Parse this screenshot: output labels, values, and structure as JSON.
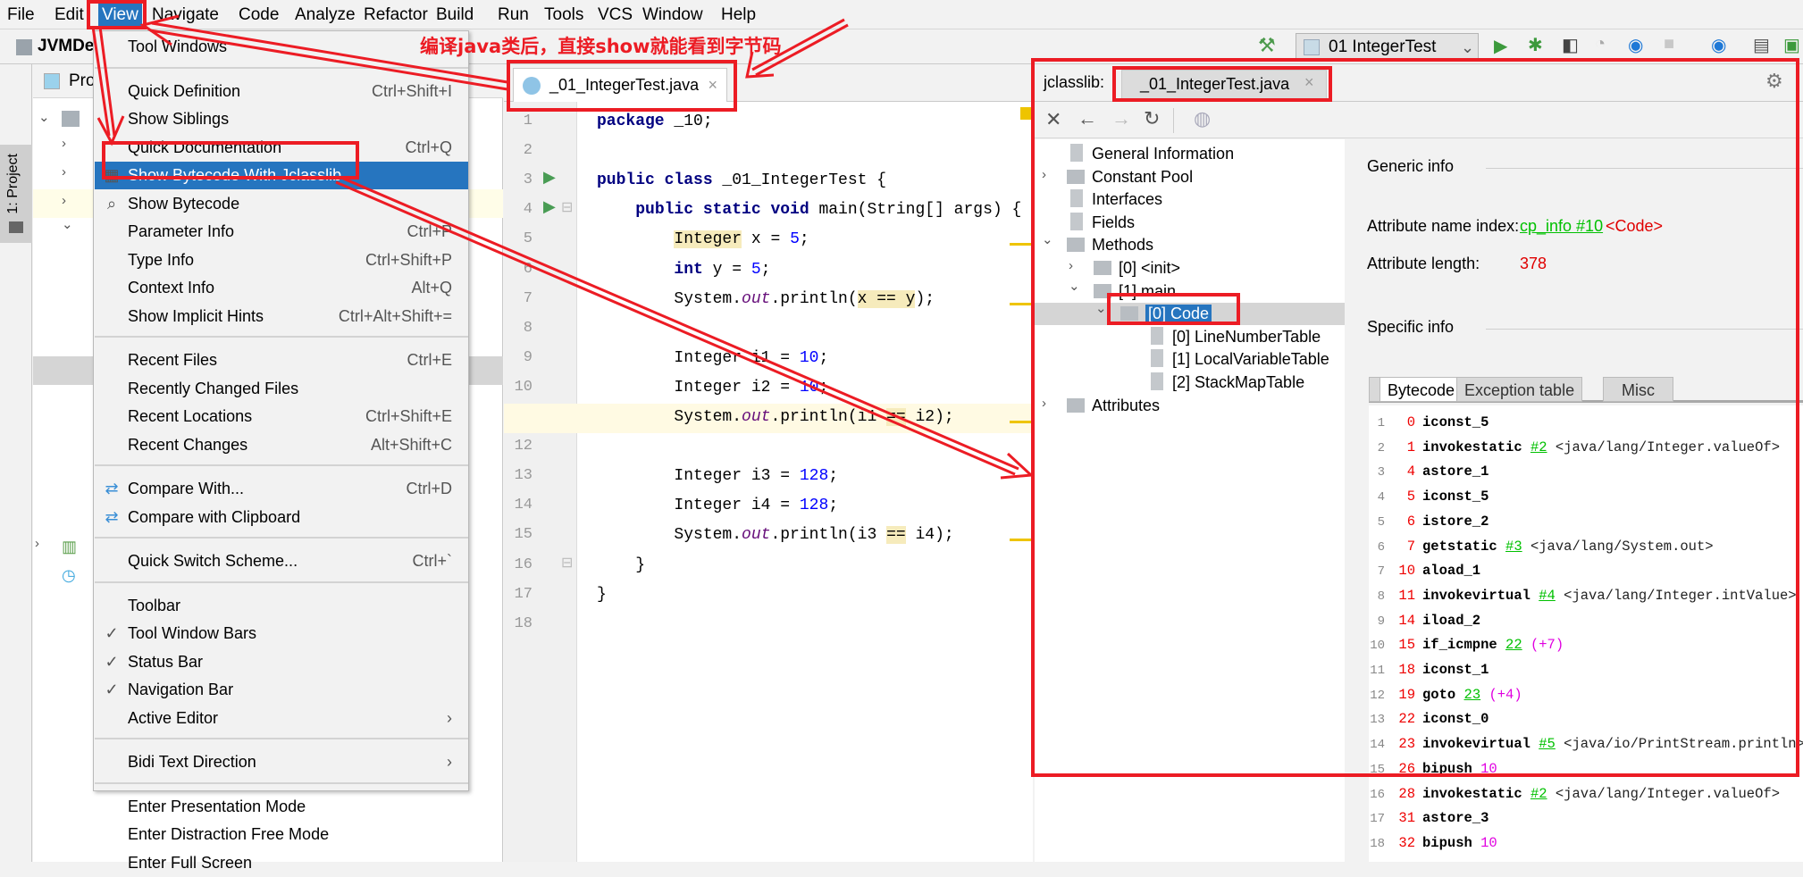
{
  "menubar": [
    "File",
    "Edit",
    "View",
    "Navigate",
    "Code",
    "Analyze",
    "Refactor",
    "Build",
    "Run",
    "Tools",
    "VCS",
    "Window",
    "Help"
  ],
  "menubar_active": "View",
  "nav": {
    "project": "JVMDe",
    "run_config": "01 IntegerTest"
  },
  "stripe": {
    "project_tab": "1: Project"
  },
  "project_panel": {
    "title": "Pro"
  },
  "annotation": "编译java类后，直接show就能看到字节码",
  "editor": {
    "tab": "_01_IntegerTest.java",
    "lines": [
      [
        [
          "package",
          "kw"
        ],
        [
          " _10;",
          ""
        ]
      ],
      [],
      [
        [
          "public class",
          "kw"
        ],
        [
          " _01_IntegerTest {",
          ""
        ]
      ],
      [
        [
          "    ",
          " "
        ],
        [
          "public static void",
          "kw"
        ],
        [
          " main(String[] args) {",
          ""
        ]
      ],
      [
        [
          "        ",
          ""
        ],
        [
          "Integer",
          "hl"
        ],
        [
          " x = ",
          ""
        ],
        [
          "5",
          "num"
        ],
        [
          ";",
          ""
        ]
      ],
      [
        [
          "        ",
          ""
        ],
        [
          "int",
          "kw"
        ],
        [
          " y = ",
          ""
        ],
        [
          "5",
          "num"
        ],
        [
          ";",
          ""
        ]
      ],
      [
        [
          "        System.",
          ""
        ],
        [
          "out",
          "fld"
        ],
        [
          ".println(",
          ""
        ],
        [
          "x == y",
          "hl"
        ],
        [
          ");",
          ""
        ]
      ],
      [],
      [
        [
          "        Integer i1 = ",
          ""
        ],
        [
          "10",
          "num"
        ],
        [
          ";",
          ""
        ]
      ],
      [
        [
          "        Integer i2 = ",
          ""
        ],
        [
          "10",
          "num"
        ],
        [
          ";",
          ""
        ]
      ],
      [
        [
          "        System.",
          ""
        ],
        [
          "out",
          "fld"
        ],
        [
          ".println(i1 ",
          ""
        ],
        [
          "==",
          "hl"
        ],
        [
          " i2);",
          ""
        ]
      ],
      [],
      [
        [
          "        Integer i3 = ",
          ""
        ],
        [
          "128",
          "num"
        ],
        [
          ";",
          ""
        ]
      ],
      [
        [
          "        Integer i4 = ",
          ""
        ],
        [
          "128",
          "num"
        ],
        [
          ";",
          ""
        ]
      ],
      [
        [
          "        System.",
          ""
        ],
        [
          "out",
          "fld"
        ],
        [
          ".println(i3 ",
          ""
        ],
        [
          "==",
          "hl"
        ],
        [
          " i4);",
          ""
        ]
      ],
      [
        [
          "    }",
          ""
        ]
      ],
      [
        [
          "}",
          ""
        ]
      ],
      []
    ],
    "current_line": 11
  },
  "menu": {
    "items": [
      {
        "label": "Tool Windows",
        "shortcut": "",
        "submenu": true
      },
      {
        "sep": true
      },
      {
        "label": "Quick Definition",
        "shortcut": "Ctrl+Shift+I"
      },
      {
        "label": "Show Siblings",
        "shortcut": ""
      },
      {
        "label": "Quick Documentation",
        "shortcut": "Ctrl+Q"
      },
      {
        "label": "Show Bytecode With Jclasslib",
        "shortcut": "",
        "selected": true,
        "icon": "bytecode-icon"
      },
      {
        "label": "Show Bytecode",
        "shortcut": "",
        "icon": "search-bytecode-icon"
      },
      {
        "label": "Parameter Info",
        "shortcut": "Ctrl+P"
      },
      {
        "label": "Type Info",
        "shortcut": "Ctrl+Shift+P"
      },
      {
        "label": "Context Info",
        "shortcut": "Alt+Q"
      },
      {
        "label": "Show Implicit Hints",
        "shortcut": "Ctrl+Alt+Shift+="
      },
      {
        "sep": true
      },
      {
        "label": "Recent Files",
        "shortcut": "Ctrl+E"
      },
      {
        "label": "Recently Changed Files",
        "shortcut": ""
      },
      {
        "label": "Recent Locations",
        "shortcut": "Ctrl+Shift+E"
      },
      {
        "label": "Recent Changes",
        "shortcut": "Alt+Shift+C"
      },
      {
        "sep": true
      },
      {
        "label": "Compare With...",
        "shortcut": "Ctrl+D",
        "icon": "compare-icon"
      },
      {
        "label": "Compare with Clipboard",
        "shortcut": "",
        "icon": "compare-clipboard-icon"
      },
      {
        "sep": true
      },
      {
        "label": "Quick Switch Scheme...",
        "shortcut": "Ctrl+`"
      },
      {
        "sep": true
      },
      {
        "label": "Toolbar",
        "shortcut": ""
      },
      {
        "label": "Tool Window Bars",
        "shortcut": "",
        "checked": true
      },
      {
        "label": "Status Bar",
        "shortcut": "",
        "checked": true
      },
      {
        "label": "Navigation Bar",
        "shortcut": "",
        "checked": true
      },
      {
        "label": "Active Editor",
        "shortcut": "",
        "submenu": true
      },
      {
        "sep": true
      },
      {
        "label": "Bidi Text Direction",
        "shortcut": "",
        "submenu": true
      },
      {
        "sep": true
      },
      {
        "label": "Enter Presentation Mode",
        "shortcut": ""
      },
      {
        "label": "Enter Distraction Free Mode",
        "shortcut": ""
      },
      {
        "label": "Enter Full Screen",
        "shortcut": ""
      }
    ]
  },
  "jclasslib": {
    "prefix": "jclasslib:",
    "tab": "_01_IntegerTest.java",
    "tree": [
      {
        "label": "General Information",
        "level": 0,
        "type": "doc"
      },
      {
        "label": "Constant Pool",
        "level": 0,
        "type": "folder",
        "exp": "closed"
      },
      {
        "label": "Interfaces",
        "level": 0,
        "type": "doc"
      },
      {
        "label": "Fields",
        "level": 0,
        "type": "doc"
      },
      {
        "label": "Methods",
        "level": 0,
        "type": "folder",
        "exp": "open"
      },
      {
        "label": "[0] <init>",
        "level": 1,
        "type": "folder",
        "exp": "closed"
      },
      {
        "label": "[1] main",
        "level": 1,
        "type": "folder",
        "exp": "open"
      },
      {
        "label": "[0] Code",
        "level": 2,
        "type": "folder",
        "exp": "open",
        "selected": true
      },
      {
        "label": "[0] LineNumberTable",
        "level": 3,
        "type": "doc"
      },
      {
        "label": "[1] LocalVariableTable",
        "level": 3,
        "type": "doc"
      },
      {
        "label": "[2] StackMapTable",
        "level": 3,
        "type": "doc"
      },
      {
        "label": "Attributes",
        "level": 0,
        "type": "folder",
        "exp": "closed"
      }
    ],
    "generic_info": "Generic info",
    "attr_name_index_label": "Attribute name index:",
    "attr_name_index_link": "cp_info #10",
    "attr_name_index_value": "<Code>",
    "attr_length_label": "Attribute length:",
    "attr_length_value": "378",
    "specific_info": "Specific info",
    "tabs": [
      "Bytecode",
      "Exception table",
      "Misc"
    ],
    "active_tab": "Bytecode",
    "bytecode": [
      {
        "n": "1",
        "off": "0",
        "ins": "iconst_5"
      },
      {
        "n": "2",
        "off": "1",
        "ins": "invokestatic",
        "ref": "#2",
        "cmt": "<java/lang/Integer.valueOf>"
      },
      {
        "n": "3",
        "off": "4",
        "ins": "astore_1"
      },
      {
        "n": "4",
        "off": "5",
        "ins": "iconst_5"
      },
      {
        "n": "5",
        "off": "6",
        "ins": "istore_2"
      },
      {
        "n": "6",
        "off": "7",
        "ins": "getstatic",
        "ref": "#3",
        "cmt": "<java/lang/System.out>"
      },
      {
        "n": "7",
        "off": "10",
        "ins": "aload_1"
      },
      {
        "n": "8",
        "off": "11",
        "ins": "invokevirtual",
        "ref": "#4",
        "cmt": "<java/lang/Integer.intValue>"
      },
      {
        "n": "9",
        "off": "14",
        "ins": "iload_2"
      },
      {
        "n": "10",
        "off": "15",
        "ins": "if_icmpne",
        "ref": "22",
        "rel": "(+7)"
      },
      {
        "n": "11",
        "off": "18",
        "ins": "iconst_1"
      },
      {
        "n": "12",
        "off": "19",
        "ins": "goto",
        "ref": "23",
        "rel": "(+4)"
      },
      {
        "n": "13",
        "off": "22",
        "ins": "iconst_0"
      },
      {
        "n": "14",
        "off": "23",
        "ins": "invokevirtual",
        "ref": "#5",
        "cmt": "<java/io/PrintStream.println>"
      },
      {
        "n": "15",
        "off": "26",
        "ins": "bipush",
        "rel": "10"
      },
      {
        "n": "16",
        "off": "28",
        "ins": "invokestatic",
        "ref": "#2",
        "cmt": "<java/lang/Integer.valueOf>"
      },
      {
        "n": "17",
        "off": "31",
        "ins": "astore_3"
      },
      {
        "n": "18",
        "off": "32",
        "ins": "bipush",
        "rel": "10"
      }
    ]
  },
  "colors": {
    "accent": "#2675bf",
    "annotation_red": "#ec1c24",
    "link_green": "#00c000",
    "offset_red": "#e00000",
    "magenta": "#e000e0"
  }
}
